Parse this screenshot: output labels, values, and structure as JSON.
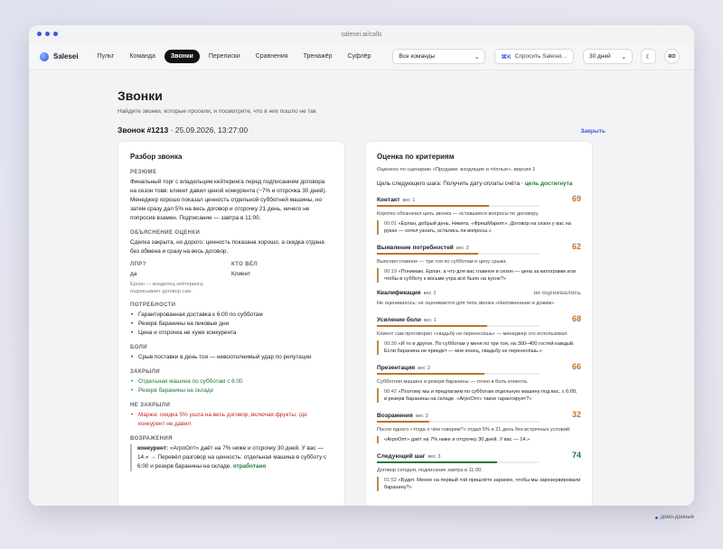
{
  "browser": {
    "url": "salesei.ai/calls"
  },
  "nav": {
    "brand": "Salesei",
    "tabs": [
      "Пульт",
      "Команда",
      "Звонки",
      "Переписки",
      "Сравнения",
      "Тренажёр",
      "Суфлёр"
    ],
    "active_tab": "Звонки",
    "team_select": "Все команды",
    "ask_key": "⌘K",
    "ask_label": "Спросить Salesei…",
    "period_select": "30 дней",
    "avatar": "RO"
  },
  "page": {
    "title": "Звонки",
    "subtitle": "Найдите звонки, которые просели, и посмотрите, что в них пошло не так",
    "call_id": "Звонок #1213",
    "call_date": " · 25.09.2026, 13:27:00",
    "close_label": "Закрыть"
  },
  "review": {
    "title": "Разбор звонка",
    "summary_h": "РЕЗЮМЕ",
    "summary": "Финальный торг с владельцем кейтеринга перед подписанием договора на сезон товв: клиент давил ценой конкурента (−7% и отсрочка 30 дней). Менеджер хорошо показал ценность отдельной субботней машины, но затем сразу дал 5% на весь договор и отсрочку 21 день, ничего не попросив взамен. Подписание — завтра в 11:00.",
    "rating_h": "ОБЪЯСНЕНИЕ ОЦЕНКИ",
    "rating": "Сделка закрыта, но дорого: ценность показана хорошо, а скидка отдана без обмена и сразу на весь договор.",
    "lpr_h": "ЛПР?",
    "lpr": "да",
    "lpr_note": "Ерлан — владелец кейтеринга, подписывает договор сам.",
    "who_h": "КТО ВЁЛ",
    "who": "Клиент",
    "needs_h": "ПОТРЕБНОСТИ",
    "needs": [
      "Гарантированная доставка к 6:00 по субботам",
      "Резерв баранины на пиковые дни",
      "Цена и отсрочка не хуже конкурента"
    ],
    "pains_h": "БОЛИ",
    "pains": [
      "Срыв поставки в день тоя — невосполнимый удар по репутации"
    ],
    "closed_h": "ЗАКРЫЛИ",
    "closed": [
      "Отдельная машина по субботам с 6:00",
      "Резерв баранины на складе"
    ],
    "notclosed_h": "НЕ ЗАКРЫЛИ",
    "notclosed": [
      "Маржа: скидка 5% ушла на весь договор, включая фрукты, где конкурент не давил"
    ],
    "objections_h": "ВОЗРАЖЕНИЯ",
    "objection_who": "конкурент:",
    "objection_text": " «АгроОпт» даёт на 7% ниже и отсрочку 30 дней. У вас — 14.» → Перевёл разговор на ценность: отдельная машина в субботу с 6:00 и резерв баранины на складе. ",
    "objection_result": "отработано"
  },
  "criteria": {
    "title": "Оценка по критериям",
    "scenario": "Оценено по сценарию «Продажи: входящие и тёплые», версия 1",
    "goal_text": "Цель следующего шага: Получить дату оплаты счёта",
    "goal_status": " · цель достигнута",
    "weight_prefix": "вес",
    "items": [
      {
        "name": "Контакт",
        "weight": "1",
        "score": "69",
        "value": 69,
        "color": "#c0742a",
        "desc": "Коротко обозначил цель звонка — оставшиеся вопросы по договору.",
        "ts": "00:01",
        "quote": "«Ерлан, добрый день, Никита, «ФрешМаркет». Договор на сезон у вас на руках — хотел узнать, остались ли вопросы.»"
      },
      {
        "name": "Выявление потребностей",
        "weight": "3",
        "score": "62",
        "value": 62,
        "color": "#c0742a",
        "desc": "Выяснил главное — три тоя по субботам и цену срыва.",
        "ts": "00:19",
        "quote": "«Понимаю. Ерлан, а что для вас главное в сезон — цена за килограмм или чтобы в субботу к восьми утра всё было на кухне?»"
      },
      {
        "name": "Квалификация",
        "weight": "2",
        "score": "не оценивалось",
        "value": null,
        "color": "#888",
        "desc": "Не оценивалось: не оценивается для типа звонка «Напоминание и дожим»",
        "ts": "",
        "quote": ""
      },
      {
        "name": "Усиление боли",
        "weight": "1",
        "score": "68",
        "value": 68,
        "color": "#c0742a",
        "desc": "Клиент сам проговорил «свадьбу не перенесёшь» — менеджер это использовал.",
        "ts": "00:30",
        "quote": "«И то и другое. По субботам у меня по три тоя, на 300–400 гостей каждый. Если баранина не приедет — мне конец, свадьбу не перенесёшь.»"
      },
      {
        "name": "Презентация",
        "weight": "2",
        "score": "66",
        "value": 66,
        "color": "#c0742a",
        "desc": "Субботняя машина и резерв баранины — точно в боль клиента.",
        "ts": "00:42",
        "quote": "«Поэтому мы и предлагаем по субботам отдельную машину под вас, с 6:00, и резерв баранины на складе. «АгроОпт» такое гарантирует?»"
      },
      {
        "name": "Возражения",
        "weight": "3",
        "score": "32",
        "value": 32,
        "color": "#c0742a",
        "desc": "После одного «тогда о чём говорим?» отдал 5% и 21 день без встречных условий.",
        "ts": "",
        "quote": "«АгроОпт» даёт на 7% ниже и отсрочку 30 дней. У вас — 14.»"
      },
      {
        "name": "Следующий шаг",
        "weight": "3",
        "score": "74",
        "value": 74,
        "color": "#1d7a3a",
        "desc": "Договор сегодня, подписание завтра в 11:00.",
        "ts": "01:52",
        "quote": "«Будет. Менее на первый той пришлёте заранее, чтобы мы зарезервировали баранину?»"
      }
    ]
  },
  "footer": {
    "demo": "демо-данные"
  }
}
